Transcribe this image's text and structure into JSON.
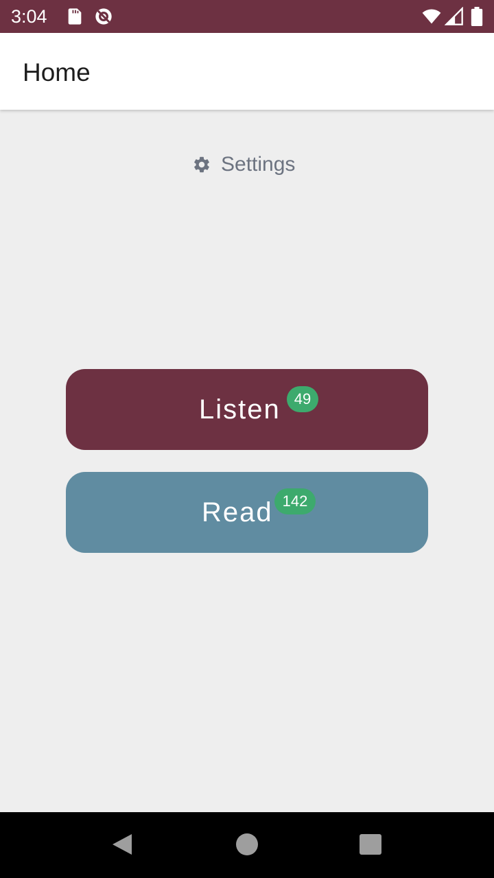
{
  "status_bar": {
    "time": "3:04",
    "icons": [
      "sd-card-icon",
      "do-not-disturb-icon",
      "wifi-icon",
      "cell-signal-icon",
      "battery-icon"
    ]
  },
  "app_bar": {
    "title": "Home"
  },
  "settings": {
    "label": "Settings",
    "icon": "gear-icon"
  },
  "actions": {
    "listen": {
      "label": "Listen",
      "count": "49",
      "color": "#6d3142"
    },
    "read": {
      "label": "Read",
      "count": "142",
      "color": "#608ca1"
    },
    "badge_color": "#3daa6d"
  },
  "nav_bar": {
    "icons": [
      "back-icon",
      "home-icon",
      "recents-icon"
    ]
  },
  "colors": {
    "primary": "#6d3142",
    "background": "#eeeeee"
  }
}
